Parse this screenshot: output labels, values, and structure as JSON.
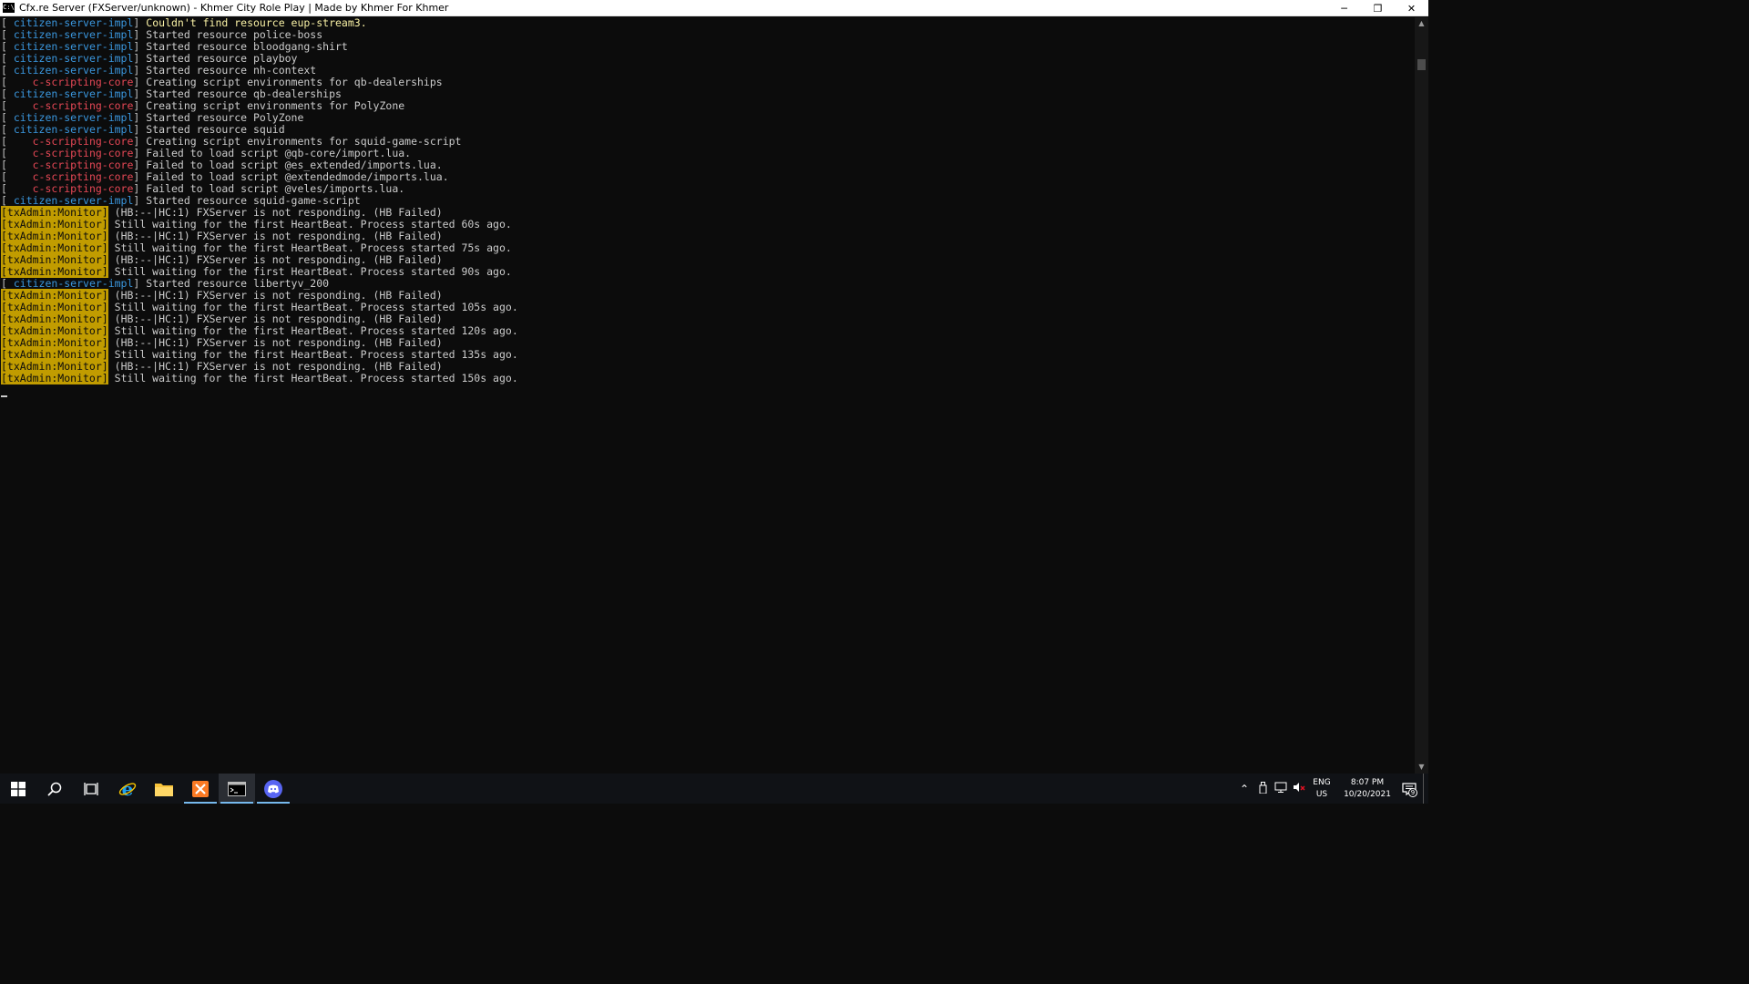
{
  "window": {
    "title": "Cfx.re Server (FXServer/unknown) - Khmer City Role Play | Made by Khmer For Khmer",
    "icon_label": "C:\\",
    "controls": {
      "minimize": "─",
      "restore": "❐",
      "close": "✕"
    }
  },
  "console": {
    "lines": [
      {
        "tag": "citizen-server-impl",
        "type": "impl",
        "message": "Couldn't find resource eup-stream3.",
        "warn": true
      },
      {
        "tag": "citizen-server-impl",
        "type": "impl",
        "message": "Started resource police-boss"
      },
      {
        "tag": "citizen-server-impl",
        "type": "impl",
        "message": "Started resource bloodgang-shirt"
      },
      {
        "tag": "citizen-server-impl",
        "type": "impl",
        "message": "Started resource playboy"
      },
      {
        "tag": "citizen-server-impl",
        "type": "impl",
        "message": "Started resource nh-context"
      },
      {
        "tag": "   c-scripting-core",
        "type": "core",
        "message": "Creating script environments for qb-dealerships"
      },
      {
        "tag": "citizen-server-impl",
        "type": "impl",
        "message": "Started resource qb-dealerships"
      },
      {
        "tag": "   c-scripting-core",
        "type": "core",
        "message": "Creating script environments for PolyZone"
      },
      {
        "tag": "citizen-server-impl",
        "type": "impl",
        "message": "Started resource PolyZone"
      },
      {
        "tag": "citizen-server-impl",
        "type": "impl",
        "message": "Started resource squid"
      },
      {
        "tag": "   c-scripting-core",
        "type": "core",
        "message": "Creating script environments for squid-game-script"
      },
      {
        "tag": "   c-scripting-core",
        "type": "core",
        "message": "Failed to load script @qb-core/import.lua."
      },
      {
        "tag": "   c-scripting-core",
        "type": "core",
        "message": "Failed to load script @es_extended/imports.lua."
      },
      {
        "tag": "   c-scripting-core",
        "type": "core",
        "message": "Failed to load script @extendedmode/imports.lua."
      },
      {
        "tag": "   c-scripting-core",
        "type": "core",
        "message": "Failed to load script @veles/imports.lua."
      },
      {
        "tag": "citizen-server-impl",
        "type": "impl",
        "message": "Started resource squid-game-script"
      },
      {
        "tag": "[txAdmin:Monitor]",
        "type": "monitor",
        "message": "(HB:--|HC:1) FXServer is not responding. (HB Failed)"
      },
      {
        "tag": "[txAdmin:Monitor]",
        "type": "monitor",
        "message": "Still waiting for the first HeartBeat. Process started 60s ago."
      },
      {
        "tag": "[txAdmin:Monitor]",
        "type": "monitor",
        "message": "(HB:--|HC:1) FXServer is not responding. (HB Failed)"
      },
      {
        "tag": "[txAdmin:Monitor]",
        "type": "monitor",
        "message": "Still waiting for the first HeartBeat. Process started 75s ago."
      },
      {
        "tag": "[txAdmin:Monitor]",
        "type": "monitor",
        "message": "(HB:--|HC:1) FXServer is not responding. (HB Failed)"
      },
      {
        "tag": "[txAdmin:Monitor]",
        "type": "monitor",
        "message": "Still waiting for the first HeartBeat. Process started 90s ago."
      },
      {
        "tag": "citizen-server-impl",
        "type": "impl",
        "message": "Started resource libertyv_200"
      },
      {
        "tag": "[txAdmin:Monitor]",
        "type": "monitor",
        "message": "(HB:--|HC:1) FXServer is not responding. (HB Failed)"
      },
      {
        "tag": "[txAdmin:Monitor]",
        "type": "monitor",
        "message": "Still waiting for the first HeartBeat. Process started 105s ago."
      },
      {
        "tag": "[txAdmin:Monitor]",
        "type": "monitor",
        "message": "(HB:--|HC:1) FXServer is not responding. (HB Failed)"
      },
      {
        "tag": "[txAdmin:Monitor]",
        "type": "monitor",
        "message": "Still waiting for the first HeartBeat. Process started 120s ago."
      },
      {
        "tag": "[txAdmin:Monitor]",
        "type": "monitor",
        "message": "(HB:--|HC:1) FXServer is not responding. (HB Failed)"
      },
      {
        "tag": "[txAdmin:Monitor]",
        "type": "monitor",
        "message": "Still waiting for the first HeartBeat. Process started 135s ago."
      },
      {
        "tag": "[txAdmin:Monitor]",
        "type": "monitor",
        "message": "(HB:--|HC:1) FXServer is not responding. (HB Failed)"
      },
      {
        "tag": "[txAdmin:Monitor]",
        "type": "monitor",
        "message": "Still waiting for the first HeartBeat. Process started 150s ago."
      }
    ]
  },
  "colors": {
    "console_bg": "#0c0c0c",
    "impl_tag": "#3a96dd",
    "core_tag": "#e74856",
    "monitor_bg": "#c19c00",
    "message": "#cccccc"
  },
  "taskbar": {
    "apps": [
      {
        "name": "start-button",
        "icon": "windows-logo-icon"
      },
      {
        "name": "search-button",
        "icon": "search-icon"
      },
      {
        "name": "task-view-button",
        "icon": "task-view-icon"
      },
      {
        "name": "edge-app",
        "icon": "internet-explorer-icon"
      },
      {
        "name": "file-explorer-app",
        "icon": "folder-icon"
      },
      {
        "name": "xampp-app",
        "icon": "xampp-icon"
      },
      {
        "name": "console-app",
        "icon": "terminal-icon"
      },
      {
        "name": "discord-app",
        "icon": "discord-icon"
      }
    ],
    "tray": {
      "language": "ENG",
      "region": "US",
      "time": "8:07 PM",
      "date": "10/20/2021",
      "notification_count": "9"
    }
  }
}
